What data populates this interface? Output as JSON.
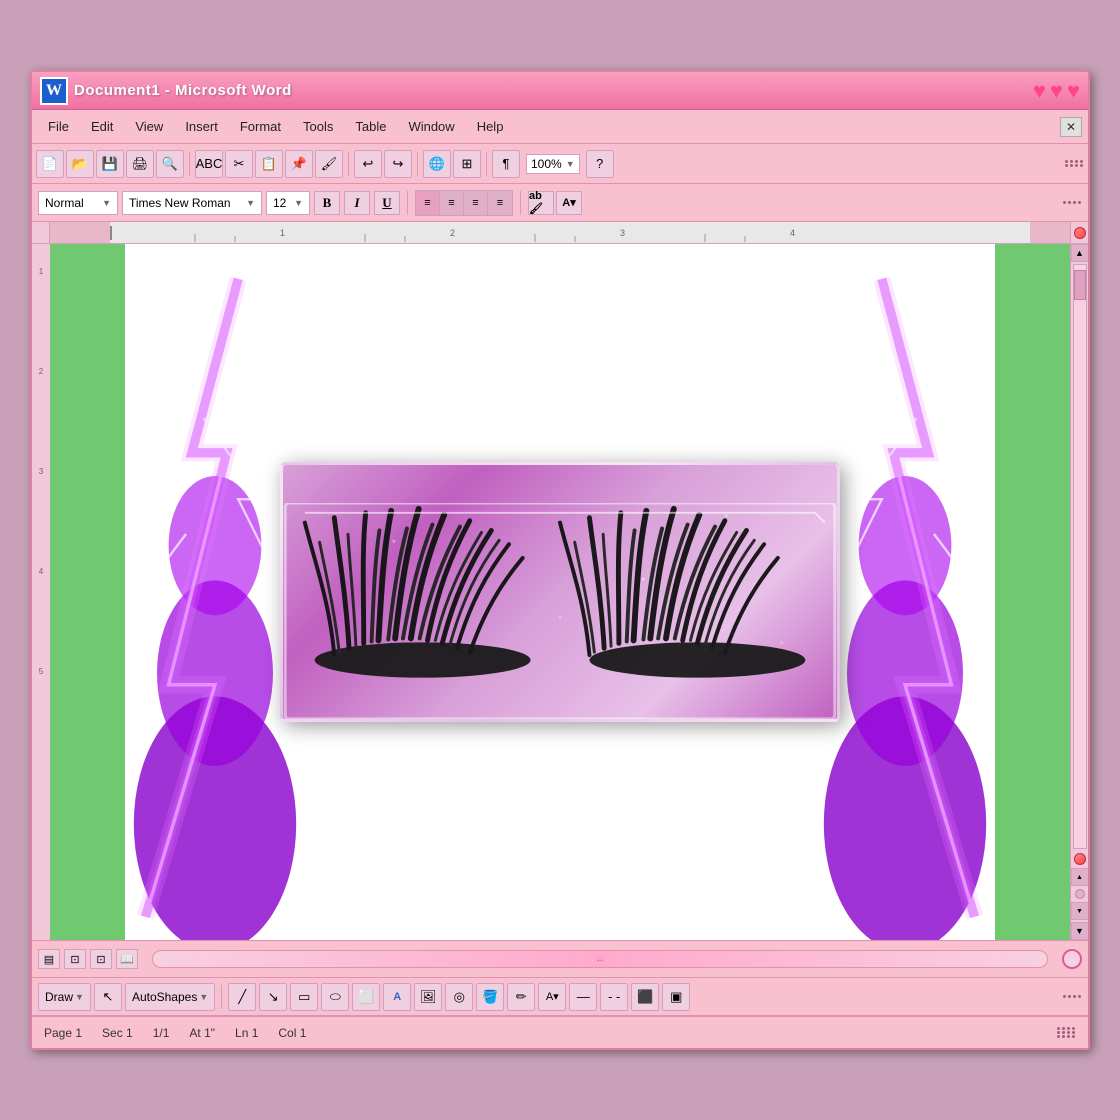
{
  "window": {
    "title": "Document1 - Microsoft Word",
    "icon_label": "W",
    "close_label": "✕"
  },
  "hearts": [
    "♥",
    "♥",
    "♥"
  ],
  "menu": {
    "items": [
      "File",
      "Edit",
      "View",
      "Insert",
      "Format",
      "Tools",
      "Table",
      "Window",
      "Help"
    ],
    "close": "✕"
  },
  "toolbar": {
    "zoom": "100%",
    "zoom_arrow": "▼"
  },
  "format_toolbar": {
    "style": "Normal",
    "font": "Times New Roman",
    "size": "12",
    "bold": "B",
    "italic": "I",
    "underline": "U",
    "align_left": "≡",
    "align_center": "≡",
    "align_right": "≡",
    "align_justify": "≡"
  },
  "document": {
    "background_color": "#70c870"
  },
  "status_bar": {
    "page": "Page 1",
    "sec": "Sec 1",
    "position": "1/1",
    "at": "At 1\"",
    "ln": "Ln 1",
    "col": "Col 1"
  },
  "draw_toolbar": {
    "draw_label": "Draw",
    "autoshapes_label": "AutoShapes"
  },
  "bottom_view": {
    "scroll_indicator": "↔",
    "view_icons": [
      "▤",
      "⊡",
      "⊡",
      "📖"
    ]
  }
}
